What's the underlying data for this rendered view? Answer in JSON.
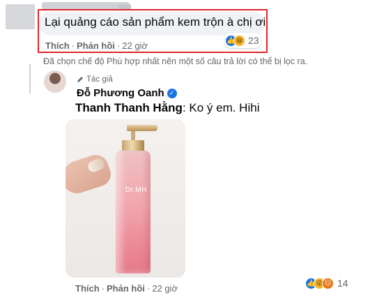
{
  "top_comment": {
    "text": "Lại quảng cáo sản phẩm kem trộn à chị ơi",
    "reaction_count": "23",
    "reactions": [
      "like-icon",
      "haha-icon"
    ],
    "like_label": "Thích",
    "reply_label": "Phản hồi",
    "time": "22 giờ"
  },
  "filter_note": "Đã chọn chế độ Phù hợp nhất nên một số câu trả lời có thể bị lọc ra.",
  "reply": {
    "author_tag": "Tác giả",
    "author_name": "Đỗ Phương Oanh",
    "mention": "Thanh Thanh Hằng",
    "text": ": Ko ý em. Hihi",
    "photo_label": "Dr.MH",
    "like_label": "Thích",
    "reply_label": "Phản hồi",
    "time": "22 giờ",
    "reaction_count": "14",
    "reactions": [
      "like-icon",
      "wow-icon",
      "sad-icon"
    ]
  },
  "colors": {
    "highlight_border": "#e0262b",
    "like_blue": "#1b74e4",
    "bubble_bg": "#f0f2f5",
    "meta_gray": "#65676b"
  }
}
